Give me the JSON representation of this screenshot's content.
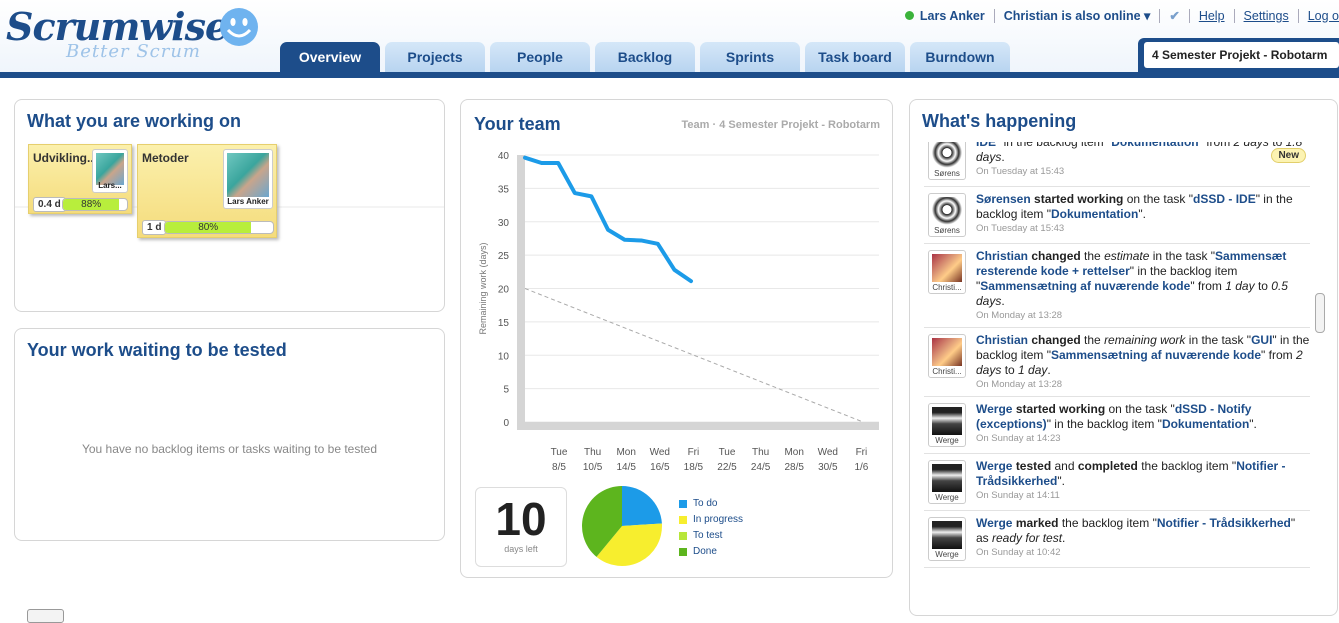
{
  "header": {
    "logo": "Scrumwise",
    "tagline": "Better Scrum",
    "user": "Lars Anker",
    "online": "Christian is also online ▾",
    "help": "Help",
    "settings": "Settings",
    "logout": "Log o",
    "project": "4 Semester Projekt - Robotarm"
  },
  "tabs": [
    "Overview",
    "Projects",
    "People",
    "Backlog",
    "Sprints",
    "Task board",
    "Burndown"
  ],
  "working": {
    "title": "What you are working on",
    "cards": [
      {
        "title": "Udvikling...",
        "person": "Lars...",
        "estimate": "0.4 d",
        "progress": "88%"
      },
      {
        "title": "Metoder",
        "person": "Lars Anker",
        "estimate": "1 d",
        "progress": "80%"
      }
    ]
  },
  "testing": {
    "title": "Your work waiting to be tested",
    "empty": "You have no backlog items or tasks waiting to be tested"
  },
  "team": {
    "title": "Your team",
    "subtitle": "Team · 4 Semester Projekt - Robotarm",
    "days_left": "10",
    "days_left_label": "days left"
  },
  "chart_data": {
    "type": "line",
    "ylabel": "Remaining work (days)",
    "ylim": [
      0,
      40
    ],
    "yticks": [
      0,
      5,
      10,
      15,
      20,
      25,
      30,
      35,
      40
    ],
    "x_labels": [
      [
        "Tue",
        "8/5"
      ],
      [
        "Thu",
        "10/5"
      ],
      [
        "Mon",
        "14/5"
      ],
      [
        "Wed",
        "16/5"
      ],
      [
        "Fri",
        "18/5"
      ],
      [
        "Tue",
        "22/5"
      ],
      [
        "Thu",
        "24/5"
      ],
      [
        "Mon",
        "28/5"
      ],
      [
        "Wed",
        "30/5"
      ],
      [
        "Fri",
        "1/6"
      ]
    ],
    "series": [
      {
        "values": [
          39.6,
          38.8,
          38.8,
          34.3,
          33.8,
          28.8,
          27.3,
          27.2,
          26.7,
          22.8,
          21.1
        ],
        "color": "#1c9be8"
      }
    ],
    "ideal": [
      20,
      0
    ],
    "pie": {
      "labels": [
        "To do",
        "In progress",
        "To test",
        "Done"
      ],
      "values": [
        24,
        37,
        0,
        39
      ],
      "colors": [
        "#1c9be8",
        "#f7ee2e",
        "#b7e63a",
        "#5db51e"
      ]
    }
  },
  "happening": {
    "title": "What's happening",
    "new_badge": "New",
    "items": [
      {
        "avatar": "Sørens",
        "html": "<b>IDE</b>\" in the backlog item \"<b>Dokumentation</b>\" from <i>2 days</i> to <i>1.8 days</i>.",
        "when": "On Tuesday at 15:43"
      },
      {
        "avatar": "Sørens",
        "html": "<b>Sørensen</b> <b style='color:#222'>started working</b> on the task \"<b>dSSD - IDE</b>\" in the backlog item \"<b>Dokumentation</b>\".",
        "when": "On Tuesday at 15:43"
      },
      {
        "avatar": "Christi...",
        "html": "<b>Christian</b> <b style='color:#222'>changed</b> the <i>estimate</i> in the task \"<b>Sammensæt resterende kode + rettelser</b>\" in the backlog item \"<b>Sammensætning af nuværende kode</b>\" from <i>1 day</i> to <i>0.5 days</i>.",
        "when": "On Monday at 13:28"
      },
      {
        "avatar": "Christi...",
        "html": "<b>Christian</b> <b style='color:#222'>changed</b> the <i>remaining work</i> in the task \"<b>GUI</b>\" in the backlog item \"<b>Sammensætning af nuværende kode</b>\" from <i>2 days</i> to <i>1 day</i>.",
        "when": "On Monday at 13:28"
      },
      {
        "avatar": "Werge",
        "html": "<b>Werge</b> <b style='color:#222'>started working</b> on the task \"<b>dSSD - Notify (exceptions)</b>\" in the backlog item \"<b>Dokumentation</b>\".",
        "when": "On Sunday at 14:23"
      },
      {
        "avatar": "Werge",
        "html": "<b>Werge</b> <b style='color:#222'>tested</b> and <b style='color:#222'>completed</b> the backlog item \"<b>Notifier - Trådsikkerhed</b>\".",
        "when": "On Sunday at 14:11"
      },
      {
        "avatar": "Werge",
        "html": "<b>Werge</b> <b style='color:#222'>marked</b> the backlog item \"<b>Notifier - Trådsikkerhed</b>\" as <i>ready for test</i>.",
        "when": "On Sunday at 10:42"
      }
    ]
  }
}
